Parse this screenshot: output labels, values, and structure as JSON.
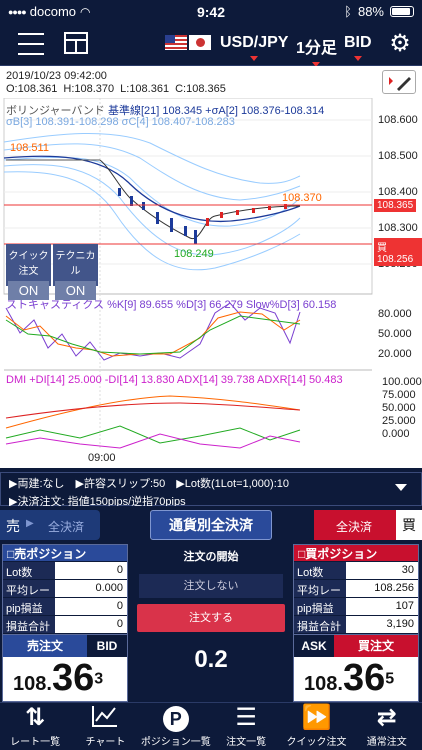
{
  "status": {
    "carrier": "docomo",
    "time": "9:42",
    "battery": "88%"
  },
  "header": {
    "pair": "USD/JPY",
    "timeframe": "1分足",
    "side": "BID"
  },
  "chart": {
    "datetime": "2019/10/23 09:42:00",
    "ohlc": {
      "o": "O:108.361",
      "h": "H:108.370",
      "l": "L:108.361",
      "c": "C:108.365"
    },
    "bb_label": "ボリンジャーバンド",
    "bb_line1": "基準線[21] 108.345 +σA[2] 108.376-108.314",
    "bb_line2": "σB[3] 108.391-108.298 σC[4] 108.407-108.283",
    "high_mark": "108.511",
    "mark_370": "108.370",
    "low_mark": "108.249",
    "y_labels": [
      "108.600",
      "108.500",
      "108.400",
      "108.300",
      "108.200"
    ],
    "price_badge": "108.365",
    "buy_badge": "買108.256",
    "stoch_label": "ストキャスティクス %K[9] 89.655 %D[3] 66.279 Slow%D[3] 60.158",
    "stoch_y": [
      "80.000",
      "50.000",
      "20.000"
    ],
    "dmi_label": "DMI +DI[14] 25.000 -DI[14] 13.830 ADX[14] 39.738 ADXR[14] 50.483",
    "dmi_y": [
      "100.000",
      "75.000",
      "50.000",
      "25.000",
      "0.000"
    ],
    "x_label": "09:00",
    "toggle_quick": "クイック注文",
    "toggle_quick_state": "ON",
    "toggle_tech": "テクニカル",
    "toggle_tech_state": "ON"
  },
  "info": {
    "line1": "▶両建:なし　▶許容スリップ:50　▶Lot数(1Lot=1,000):10",
    "line2": "▶決済注文: 指値150pips/逆指70pips"
  },
  "trade": {
    "sell_tab": "売",
    "sell_close": "全決済",
    "all_close": "通貨別全決済",
    "buy_close": "全決済",
    "buy_tab": "買",
    "sell_pos": {
      "title": "売ポジション",
      "rows": [
        {
          "k": "Lot数",
          "v": "0"
        },
        {
          "k": "平均レート",
          "v": "0.000"
        },
        {
          "k": "pip損益",
          "v": "0"
        },
        {
          "k": "損益合計",
          "v": "0"
        }
      ]
    },
    "buy_pos": {
      "title": "買ポジション",
      "rows": [
        {
          "k": "Lot数",
          "v": "30"
        },
        {
          "k": "平均レート",
          "v": "108.256"
        },
        {
          "k": "pip損益",
          "v": "107"
        },
        {
          "k": "損益合計",
          "v": "3,190"
        }
      ]
    },
    "order_start": "注文の開始",
    "no_order": "注文しない",
    "do_order": "注文する",
    "spread": "0.2",
    "sell_order": "売注文",
    "bid": "BID",
    "bid_main": "108.",
    "bid_big": "36",
    "bid_small": "3",
    "ask": "ASK",
    "buy_order": "買注文",
    "ask_main": "108.",
    "ask_big": "36",
    "ask_small": "5"
  },
  "nav": [
    {
      "icon": "swap-arrows-icon",
      "label": "レート一覧"
    },
    {
      "icon": "chart-icon",
      "label": "チャート"
    },
    {
      "icon": "position-p-icon",
      "label": "ポジション一覧"
    },
    {
      "icon": "order-list-icon",
      "label": "注文一覧"
    },
    {
      "icon": "fast-forward-icon",
      "label": "クイック注文"
    },
    {
      "icon": "exchange-icon",
      "label": "通常注文"
    }
  ]
}
